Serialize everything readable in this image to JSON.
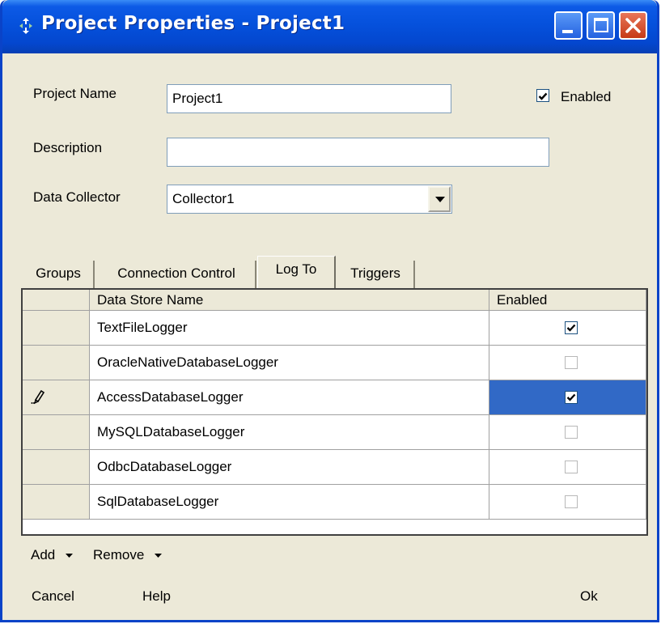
{
  "window": {
    "title": "Project Properties - Project1"
  },
  "form": {
    "project_name_label": "Project Name",
    "project_name_value": "Project1",
    "enabled_label": "Enabled",
    "description_label": "Description",
    "description_value": "",
    "data_collector_label": "Data Collector",
    "data_collector_value": "Collector1"
  },
  "tabs": [
    {
      "label": "Groups"
    },
    {
      "label": "Connection Control"
    },
    {
      "label": "Log To"
    },
    {
      "label": "Triggers"
    }
  ],
  "active_tab": "Log To",
  "grid": {
    "columns": [
      "Data Store Name",
      "Enabled"
    ],
    "rows": [
      {
        "name": "TextFileLogger",
        "enabled": true
      },
      {
        "name": "OracleNativeDatabaseLogger",
        "enabled": false
      },
      {
        "name": "AccessDatabaseLogger",
        "enabled": true
      },
      {
        "name": "MySQLDatabaseLogger",
        "enabled": false
      },
      {
        "name": "OdbcDatabaseLogger",
        "enabled": false
      },
      {
        "name": "SqlDatabaseLogger",
        "enabled": false
      }
    ],
    "editing_row": 2
  },
  "toolbar": {
    "add_label": "Add",
    "remove_label": "Remove"
  },
  "footer": {
    "cancel_label": "Cancel",
    "help_label": "Help",
    "ok_label": "Ok"
  },
  "colors": {
    "titlebar": "#0551dc",
    "selection": "#3169c6",
    "dialog_bg": "#ece9d8"
  },
  "icons": [
    "app-icon",
    "minimize-icon",
    "maximize-icon",
    "close-icon",
    "pencil-icon",
    "chevron-down-icon"
  ]
}
